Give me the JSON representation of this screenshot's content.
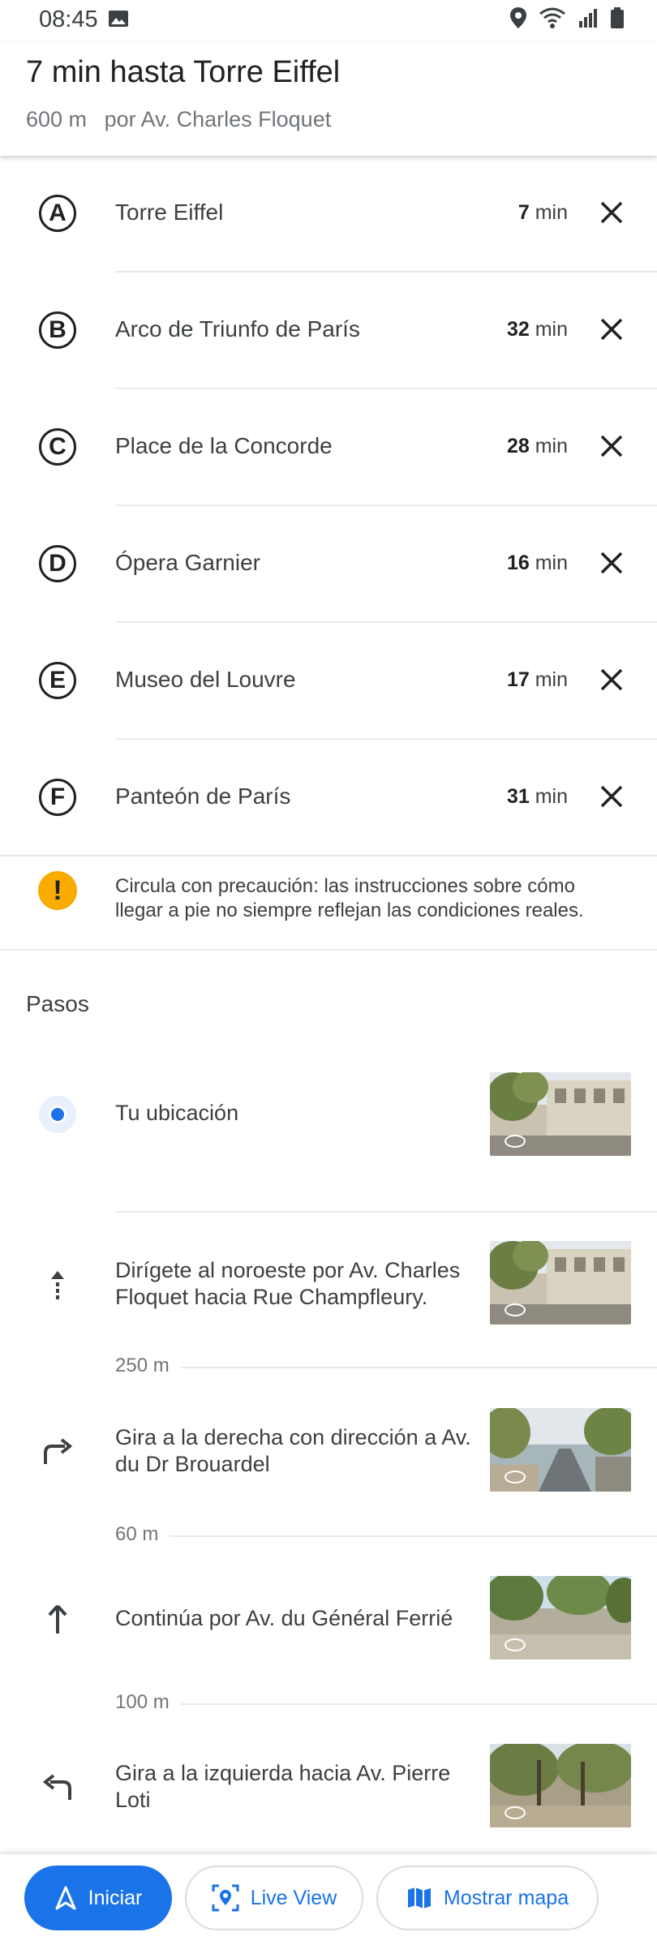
{
  "status_bar": {
    "time": "08:45"
  },
  "header": {
    "title": "7 min hasta Torre Eiffel",
    "distance": "600 m",
    "via": "por Av. Charles Floquet"
  },
  "stops": [
    {
      "letter": "A",
      "name": "Torre Eiffel",
      "minutes": "7",
      "unit": "min"
    },
    {
      "letter": "B",
      "name": "Arco de Triunfo de París",
      "minutes": "32",
      "unit": "min"
    },
    {
      "letter": "C",
      "name": "Place de la Concorde",
      "minutes": "28",
      "unit": "min"
    },
    {
      "letter": "D",
      "name": "Ópera Garnier",
      "minutes": "16",
      "unit": "min"
    },
    {
      "letter": "E",
      "name": "Museo del Louvre",
      "minutes": "17",
      "unit": "min"
    },
    {
      "letter": "F",
      "name": "Panteón de París",
      "minutes": "31",
      "unit": "min"
    }
  ],
  "warning": {
    "icon": "exclamation-icon",
    "text": "Circula con precaución: las instrucciones sobre cómo llegar a pie no siempre reflejan las condiciones reales."
  },
  "steps_title": "Pasos",
  "steps": [
    {
      "icon": "location-dot-icon",
      "text": "Tu ubicación",
      "distance": ""
    },
    {
      "icon": "arrow-up-dotted-icon",
      "text": "Dirígete al noroeste por Av. Charles Floquet hacia Rue Champfleury.",
      "distance": "250 m"
    },
    {
      "icon": "turn-right-icon",
      "text": "Gira a la derecha con dirección a Av. du Dr Brouardel",
      "distance": "60 m"
    },
    {
      "icon": "arrow-up-icon",
      "text": "Continúa por Av. du Général Ferrié",
      "distance": "100 m"
    },
    {
      "icon": "turn-left-icon",
      "text": "Gira a la izquierda hacia Av. Pierre Loti",
      "distance": ""
    }
  ],
  "bottom": {
    "start_label": "Iniciar",
    "live_view_label": "Live View",
    "map_label": "Mostrar mapa"
  },
  "colors": {
    "accent": "#1a73e8",
    "warning": "#f9ab00",
    "text": "#202124",
    "muted": "#70757a"
  }
}
